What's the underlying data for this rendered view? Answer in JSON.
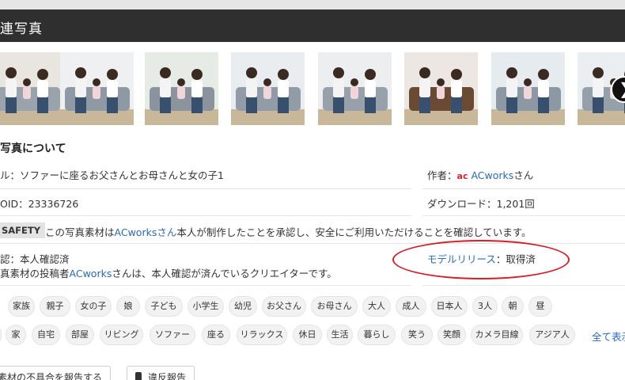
{
  "header": {
    "title": "連写真"
  },
  "thumbnails": [
    {
      "name": "photo-thumb-1",
      "bg": "#e8e6df",
      "sofa": "#9aa3ab"
    },
    {
      "name": "photo-thumb-2",
      "bg": "#eef0f2",
      "sofa": "#8f99a3"
    },
    {
      "name": "photo-thumb-3",
      "bg": "#e7ebe6",
      "sofa": "#8b949c"
    },
    {
      "name": "photo-thumb-4",
      "bg": "#e9edf0",
      "sofa": "#929ca6"
    },
    {
      "name": "photo-thumb-5",
      "bg": "#edeef0",
      "sofa": "#98a1aa"
    },
    {
      "name": "photo-thumb-6",
      "bg": "#ece7e2",
      "sofa": "#6b4a33"
    },
    {
      "name": "photo-thumb-7",
      "bg": "#e6ebef",
      "sofa": "#8c98a4"
    },
    {
      "name": "photo-thumb-8",
      "bg": "#eaeef1",
      "sofa": "#96a0a9"
    }
  ],
  "about": {
    "heading": "写真について",
    "title_line": "ル：ソファーに座るお父さんとお母さんと女の子1",
    "id_line": "OID：23336726",
    "author_label": "作者：",
    "author_icon": "ac",
    "author_name": "ACworks",
    "author_suffix": "さん",
    "downloads": "ダウンロード：1,201回",
    "safety_badge": "SAFETY",
    "safety_text_1": "この写真素材は",
    "safety_link": "ACworksさん",
    "safety_text_2": "本人が制作したことを承認し、安全にご利用いただけることを確認しています。",
    "verify_line": "認：本人確認済",
    "creator_prefix": "真素材の投稿者",
    "creator_link": "ACworks",
    "creator_suffix": "さんは、本人確認が済んでいるクリエイターです。",
    "release_label": "モデルリリース",
    "release_value": "：取得済"
  },
  "tags_row1": [
    "家族",
    "親子",
    "女の子",
    "娘",
    "子ども",
    "小学生",
    "幼児",
    "お父さん",
    "お母さん",
    "大人",
    "成人",
    "日本人",
    "3人",
    "朝",
    "昼"
  ],
  "tags_row2": [
    "",
    "家",
    "自宅",
    "部屋",
    "リビング",
    "ソファー",
    "座る",
    "リラックス",
    "休日",
    "生活",
    "暮らし",
    "笑う",
    "笑顔",
    "カメラ目線",
    "アジア人"
  ],
  "show_all": "全て表示",
  "report_material": "素材の不具合を報告する",
  "violation_report": "違反報告",
  "colors": {
    "header_bg": "#2f2f2f",
    "link": "#2a6ab8",
    "annotation": "#d61e2a"
  }
}
